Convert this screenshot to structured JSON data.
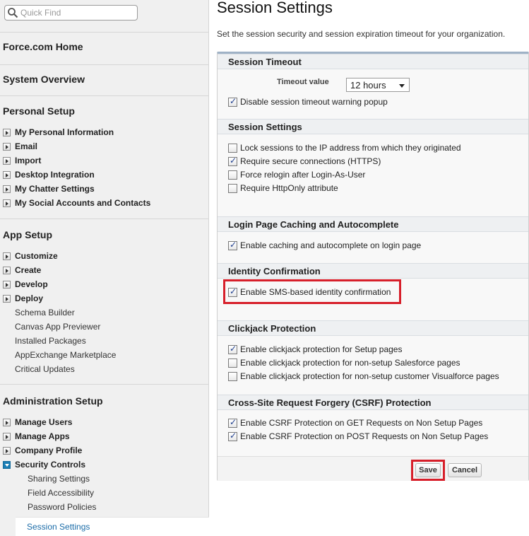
{
  "quick_find": {
    "placeholder": "Quick Find"
  },
  "sidebar": {
    "top_links": [
      "Force.com Home",
      "System Overview"
    ],
    "personal_setup": {
      "heading": "Personal Setup",
      "items": [
        "My Personal Information",
        "Email",
        "Import",
        "Desktop Integration",
        "My Chatter Settings",
        "My Social Accounts and Contacts"
      ]
    },
    "app_setup": {
      "heading": "App Setup",
      "items": [
        "Customize",
        "Create",
        "Develop",
        "Deploy"
      ],
      "links": [
        "Schema Builder",
        "Canvas App Previewer",
        "Installed Packages",
        "AppExchange Marketplace",
        "Critical Updates"
      ]
    },
    "admin_setup": {
      "heading": "Administration Setup",
      "items": [
        "Manage Users",
        "Manage Apps",
        "Company Profile",
        "Security Controls"
      ],
      "sub_items": [
        "Sharing Settings",
        "Field Accessibility",
        "Password Policies"
      ],
      "active": "Session Settings"
    }
  },
  "main": {
    "title": "Session Settings",
    "description": "Set the session security and session expiration timeout for your organization.",
    "sections": {
      "timeout": {
        "title": "Session Timeout",
        "timeout_label": "Timeout value",
        "timeout_value": "12 hours",
        "options": [
          {
            "label": "Disable session timeout warning popup",
            "checked": true
          }
        ]
      },
      "session": {
        "title": "Session Settings",
        "options": [
          {
            "label": "Lock sessions to the IP address from which they originated",
            "checked": false
          },
          {
            "label": "Require secure connections (HTTPS)",
            "checked": true
          },
          {
            "label": "Force relogin after Login-As-User",
            "checked": false
          },
          {
            "label": "Require HttpOnly attribute",
            "checked": false
          }
        ]
      },
      "login_cache": {
        "title": "Login Page Caching and Autocomplete",
        "options": [
          {
            "label": "Enable caching and autocomplete on login page",
            "checked": true
          }
        ]
      },
      "identity": {
        "title": "Identity Confirmation",
        "options": [
          {
            "label": "Enable SMS-based identity confirmation",
            "checked": true
          }
        ]
      },
      "clickjack": {
        "title": "Clickjack Protection",
        "options": [
          {
            "label": "Enable clickjack protection for Setup pages",
            "checked": true
          },
          {
            "label": "Enable clickjack protection for non-setup Salesforce pages",
            "checked": false
          },
          {
            "label": "Enable clickjack protection for non-setup customer Visualforce pages",
            "checked": false
          }
        ]
      },
      "csrf": {
        "title": "Cross-Site Request Forgery (CSRF) Protection",
        "options": [
          {
            "label": "Enable CSRF Protection on GET Requests on Non Setup Pages",
            "checked": true
          },
          {
            "label": "Enable CSRF Protection on POST Requests on Non Setup Pages",
            "checked": true
          }
        ]
      }
    },
    "buttons": {
      "save": "Save",
      "cancel": "Cancel"
    }
  },
  "colors": {
    "highlight": "#d71f2a",
    "link": "#1b6ca8",
    "panel_border": "#9fb2c6"
  }
}
